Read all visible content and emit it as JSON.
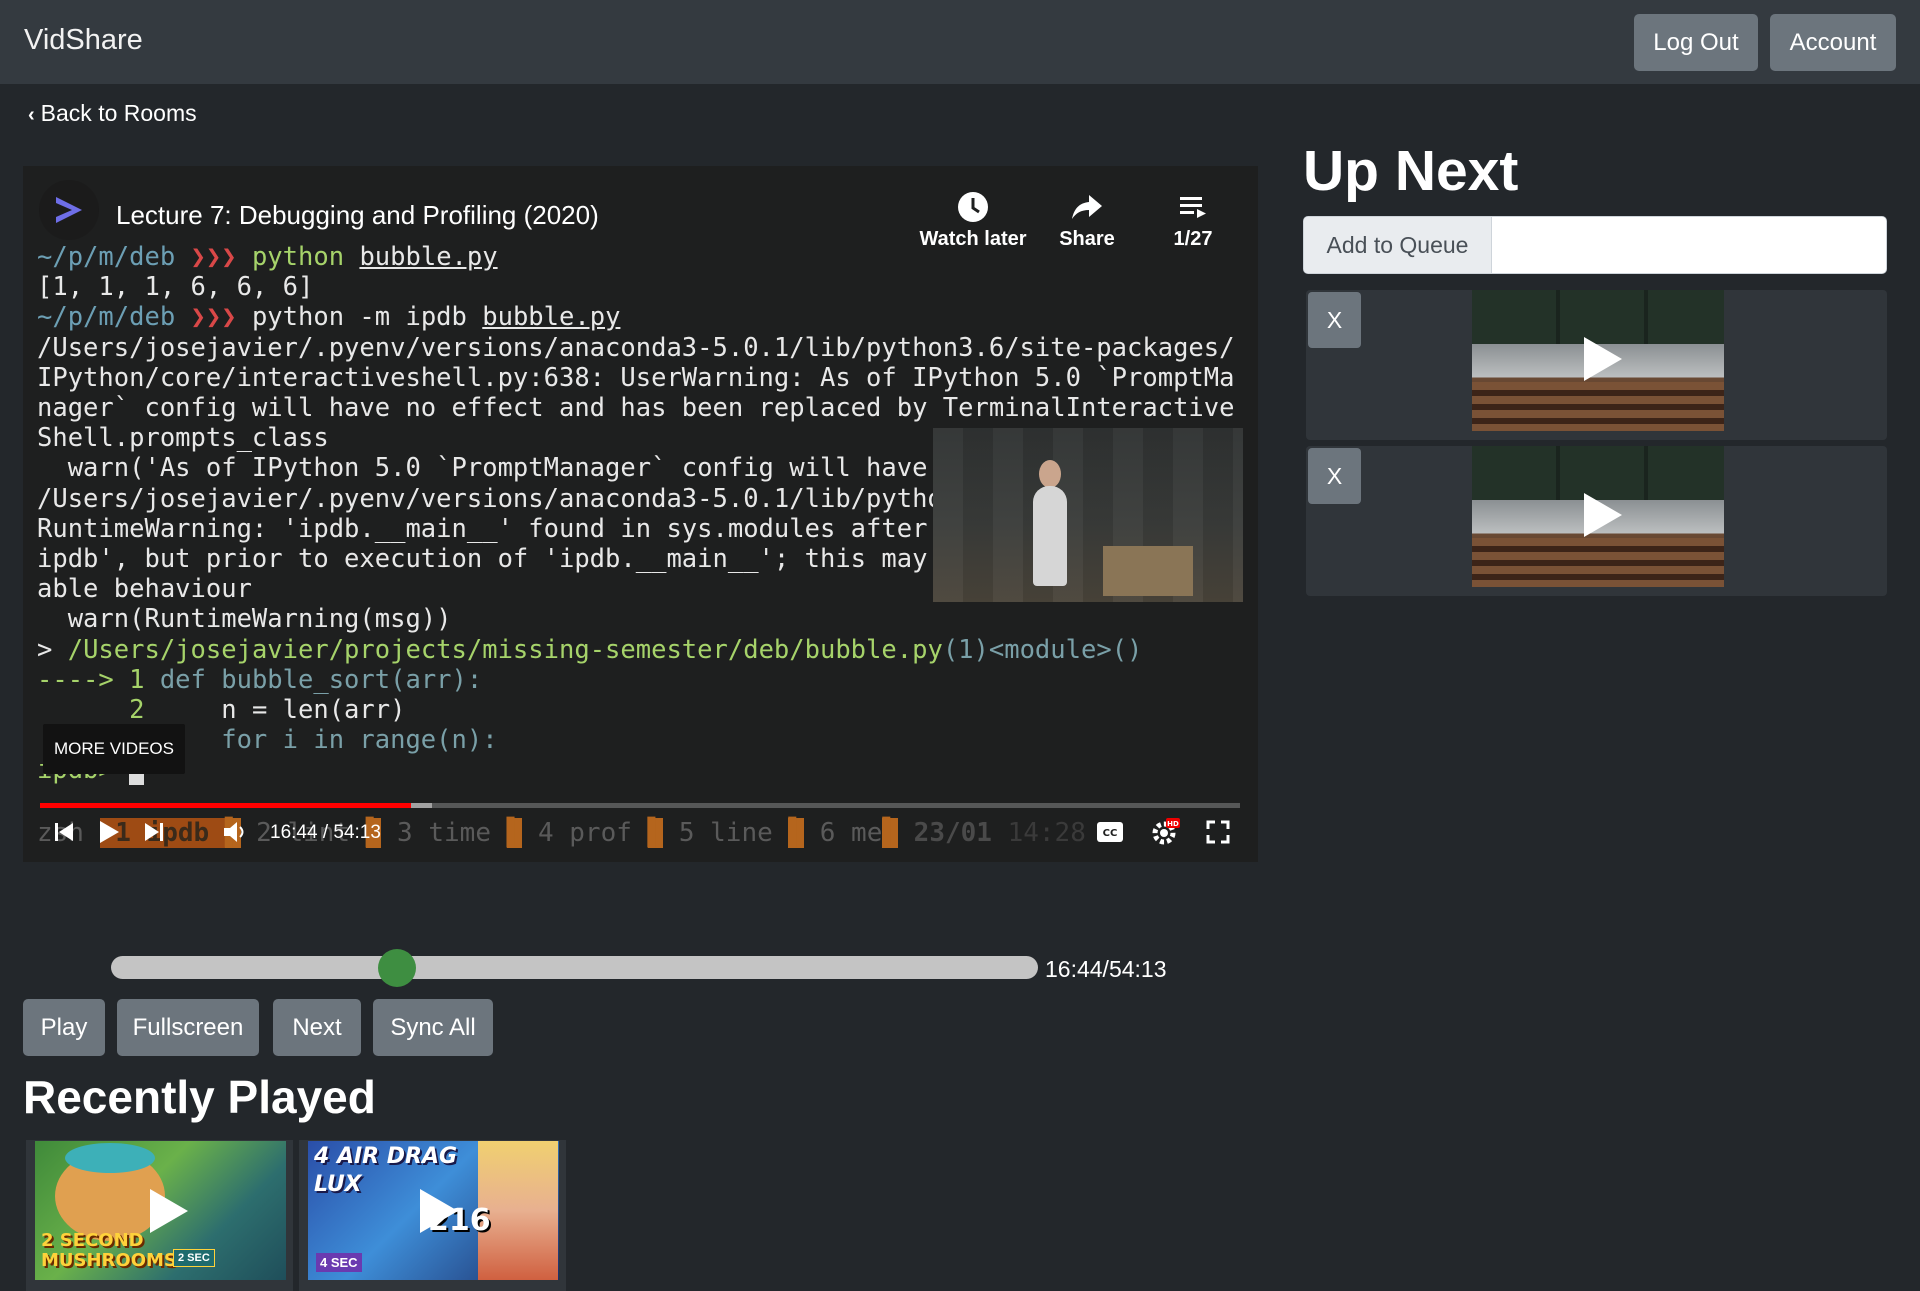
{
  "app": {
    "brand": "VidShare"
  },
  "nav": {
    "logout_label": "Log Out",
    "account_label": "Account"
  },
  "back_link": {
    "label": "Back to Rooms"
  },
  "player": {
    "title": "Lecture 7: Debugging and Profiling (2020)",
    "watch_later_label": "Watch later",
    "share_label": "Share",
    "playlist_position": "1/27",
    "more_videos_label": "MORE VIDEOS",
    "time_display": "16:44 / 54:13",
    "progress_fraction": 0.309,
    "terminal": {
      "line1_path": "~/p/m/deb",
      "line1_cmd": "python",
      "line1_arg": "bubble.py",
      "line2": "[1, 1, 1, 6, 6, 6]",
      "line3_path": "~/p/m/deb",
      "line3_cmd": "python -m ipdb",
      "line3_arg": "bubble.py",
      "line4": "/Users/josejavier/.pyenv/versions/anaconda3-5.0.1/lib/python3.6/site-packages/",
      "line5": "IPython/core/interactiveshell.py:638: UserWarning: As of IPython 5.0 `PromptMa",
      "line6": "nager` config will have no effect and has been replaced by TerminalInteractive",
      "line7": "Shell.prompts_class",
      "line8": "  warn('As of IPython 5.0 `PromptManager` config will have no effect'",
      "line9": "/Users/josejavier/.pyenv/versions/anaconda3-5.0.1/lib/python3.6/runpy.py:125:",
      "line10": "RuntimeWarning: 'ipdb.__main__' found in sys.modules after import of package",
      "line11": "ipdb', but prior to execution of 'ipdb.__main__'; this may result in unpredict",
      "line12": "able behaviour",
      "line13": "  warn(RuntimeWarning(msg))",
      "line14_prefix": "> ",
      "line14_path": "/Users/josejavier/projects/missing-semester/deb/bubble.py",
      "line14_suffix": "(1)<module>()",
      "line15_arrow": "----> 1 ",
      "line15_code": "def bubble_sort(arr):",
      "line16_num": "      2     ",
      "line16_code": "n = len(arr)",
      "line17_code": "      3     for i in range(n):",
      "prompt": "ipdb> "
    },
    "tmux": {
      "session": "zsh",
      "win1": " 1 ipdb ",
      "win2": " 2 lint ",
      "win3": " 3 time ",
      "win4": " 4 prof ",
      "win5": " 5 line ",
      "win6": " 6 me",
      "date": " 23/01 ",
      "clock": "14:28"
    }
  },
  "seek": {
    "time_label": "16:44/54:13",
    "fraction": 0.309
  },
  "controls": {
    "play": "Play",
    "fullscreen": "Fullscreen",
    "next": "Next",
    "sync_all": "Sync All"
  },
  "recent": {
    "heading": "Recently Played",
    "items": [
      {
        "overlay_text": "2 SECOND MUSHROOMS",
        "badge": "2 SEC"
      },
      {
        "overlay_text": "4 AIR DRAG LUX",
        "badge": "4 SEC",
        "number": "216"
      }
    ]
  },
  "up_next": {
    "heading": "Up Next",
    "add_to_queue_label": "Add to Queue",
    "queue_input_value": "",
    "remove_label": "X"
  }
}
